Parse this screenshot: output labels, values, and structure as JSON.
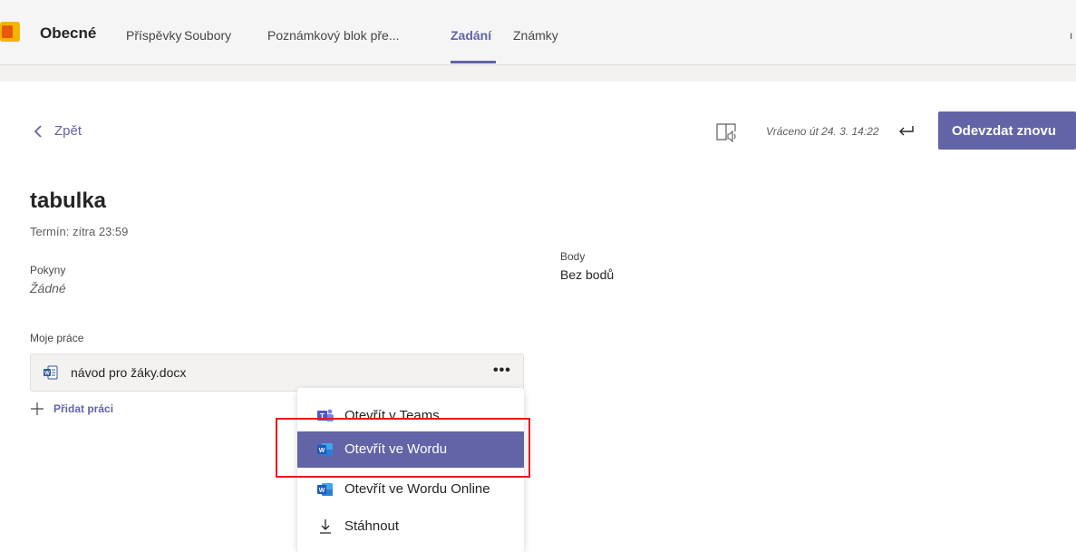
{
  "header": {
    "channel_title": "Obecné",
    "tabs": [
      {
        "label": "Příspěvky"
      },
      {
        "label": "Soubory"
      },
      {
        "label": "Poznámkový blok pře..."
      },
      {
        "label": "Zadání",
        "active": true
      },
      {
        "label": "Známky"
      }
    ],
    "edge_mark": "ı"
  },
  "toolbar": {
    "back_label": "Zpět",
    "returned_label": "Vráceno út 24. 3. 14:22",
    "resubmit_label": "Odevzdat znovu"
  },
  "assignment": {
    "title": "tabulka",
    "due": "Termín: zítra 23:59",
    "instructions_label": "Pokyny",
    "instructions_value": "Žádné",
    "points_label": "Body",
    "points_value": "Bez bodů",
    "my_work_label": "Moje práce",
    "file_name": "návod pro žáky.docx",
    "more_label": "•••",
    "add_work_label": "Přidat práci"
  },
  "context_menu": {
    "items": [
      {
        "label": "Otevřít v Teams",
        "icon": "teams-icon"
      },
      {
        "label": "Otevřít ve Wordu",
        "icon": "word-icon",
        "highlighted": true
      },
      {
        "label": "Otevřít ve Wordu Online",
        "icon": "word-icon"
      },
      {
        "label": "Stáhnout",
        "icon": "download-icon"
      }
    ]
  },
  "colors": {
    "accent": "#6264a7",
    "callout": "#e8191c",
    "word_blue": "#2b579a"
  }
}
